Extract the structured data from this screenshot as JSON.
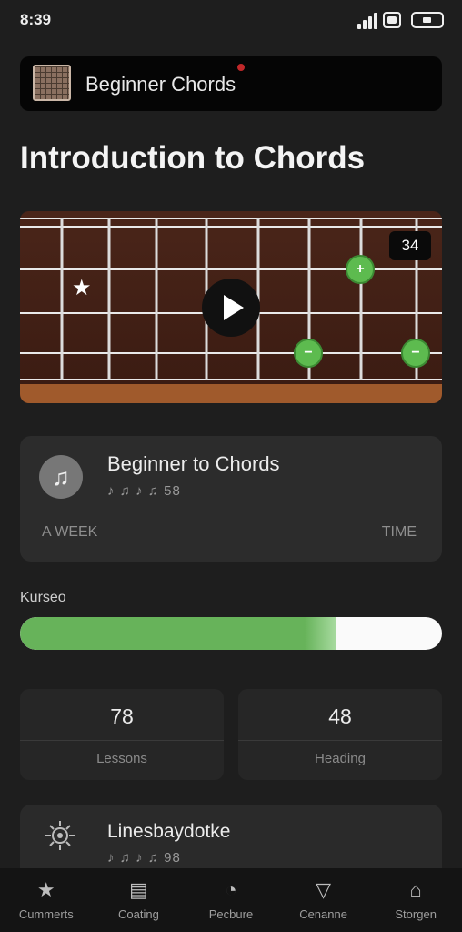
{
  "status_bar": {
    "time": "8:39"
  },
  "header": {
    "title": "Beginner Chords"
  },
  "page": {
    "title": "Introduction to Chords"
  },
  "video": {
    "time_badge": "34"
  },
  "lesson_card": {
    "title": "Beginner to Chords",
    "subtitle": "♪ ♫ ♪ ♫ 58",
    "meta_left": "A WEEK",
    "meta_right": "TIME"
  },
  "progress": {
    "label": "Kurseo",
    "value": 0.75
  },
  "stats": [
    {
      "value": "78",
      "label": "Lessons"
    },
    {
      "value": "48",
      "label": "Heading"
    }
  ],
  "bottom_card": {
    "title": "Linesbaydotke",
    "subtitle": "♪ ♫ ♪ ♫ 98"
  },
  "tabs": [
    {
      "label": "Cummerts",
      "icon": "star-icon"
    },
    {
      "label": "Coating",
      "icon": "chart-icon"
    },
    {
      "label": "Pecbure",
      "icon": "timer-icon"
    },
    {
      "label": "Cenanne",
      "icon": "cup-icon"
    },
    {
      "label": "Storgen",
      "icon": "home-icon"
    }
  ]
}
